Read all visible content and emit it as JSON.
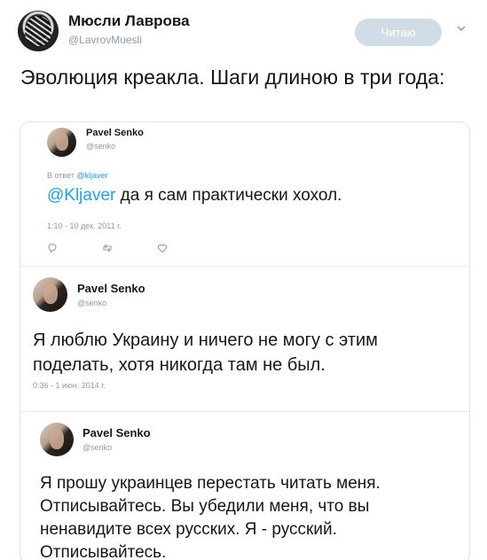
{
  "author": {
    "name": "Мюсли Лаврова",
    "handle": "@LavrovMuesli"
  },
  "follow_button": {
    "label": "Читаю"
  },
  "tweet": {
    "text": "Эволюция креакла. Шаги длиною в три года:"
  },
  "embedded": {
    "tweet1": {
      "name": "Pavel Senko",
      "handle": "@senko",
      "reply_prefix": "В ответ",
      "reply_mention": "@kljaver",
      "text_mention": "@Kljaver",
      "text": " да я сам практически хохол.",
      "time": "1:10 - 10 дек. 2011 г."
    },
    "tweet2": {
      "name": "Pavel Senko",
      "handle": "@senko",
      "text": "Я люблю Украину и ничего не могу с этим поделать, хотя никогда там не был.",
      "time": "0:36 - 1 июн. 2014 г."
    },
    "tweet3": {
      "name": "Pavel Senko",
      "handle": "@senko",
      "text": "Я прошу украинцев перестать читать меня. Отписывайтесь. Вы убедили меня, что вы ненавидите всех русских. Я - русский. Отписывайтесь."
    }
  },
  "icons": [
    "avatar",
    "chevron-down-icon",
    "reply-icon",
    "retweet-icon",
    "like-icon"
  ],
  "colors": {
    "link": "#1da1f2",
    "follow_button_bg": "#d1dde6",
    "muted": "#8a9aa8"
  }
}
